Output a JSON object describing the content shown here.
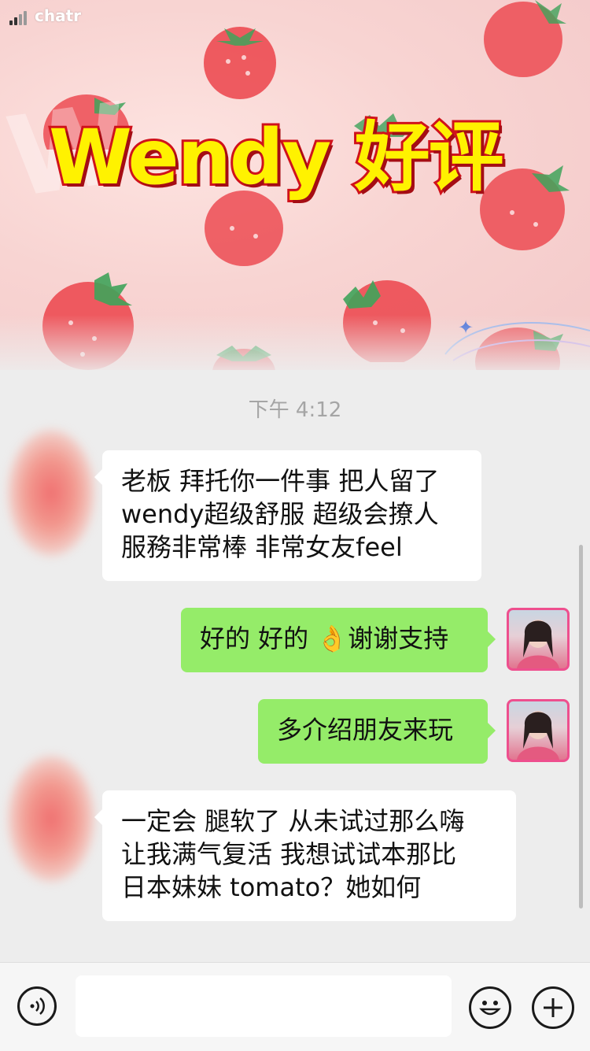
{
  "status_bar": {
    "carrier": "chatr"
  },
  "banner": {
    "title": "Wendy 好评",
    "colors": {
      "title_fill": "#fff200",
      "title_stroke": "#d0121b",
      "berry": "#ec4b52",
      "leaf": "#3fa35a"
    }
  },
  "chat": {
    "timestamp": "下午 4:12",
    "messages": [
      {
        "side": "in",
        "lines": [
          "老板 拜托你一件事 把人留了",
          "wendy超级舒服 超级会撩人",
          "服務非常棒 非常女友feel"
        ]
      },
      {
        "side": "out",
        "text": "好的 好的 👌谢谢支持"
      },
      {
        "side": "out",
        "text": "多介绍朋友来玩"
      },
      {
        "side": "in",
        "lines": [
          "一定会 腿软了 从未试过那么嗨",
          "让我满气复活 我想试试本那比",
          "日本妹妹 tomato？她如何"
        ]
      }
    ],
    "colors": {
      "incoming_bubble": "#ffffff",
      "outgoing_bubble": "#95ec69",
      "background": "#ededed"
    }
  },
  "input_bar": {
    "voice_icon": "voice-icon",
    "emoji_icon": "emoji-icon",
    "plus_icon": "plus-icon",
    "text_value": ""
  }
}
